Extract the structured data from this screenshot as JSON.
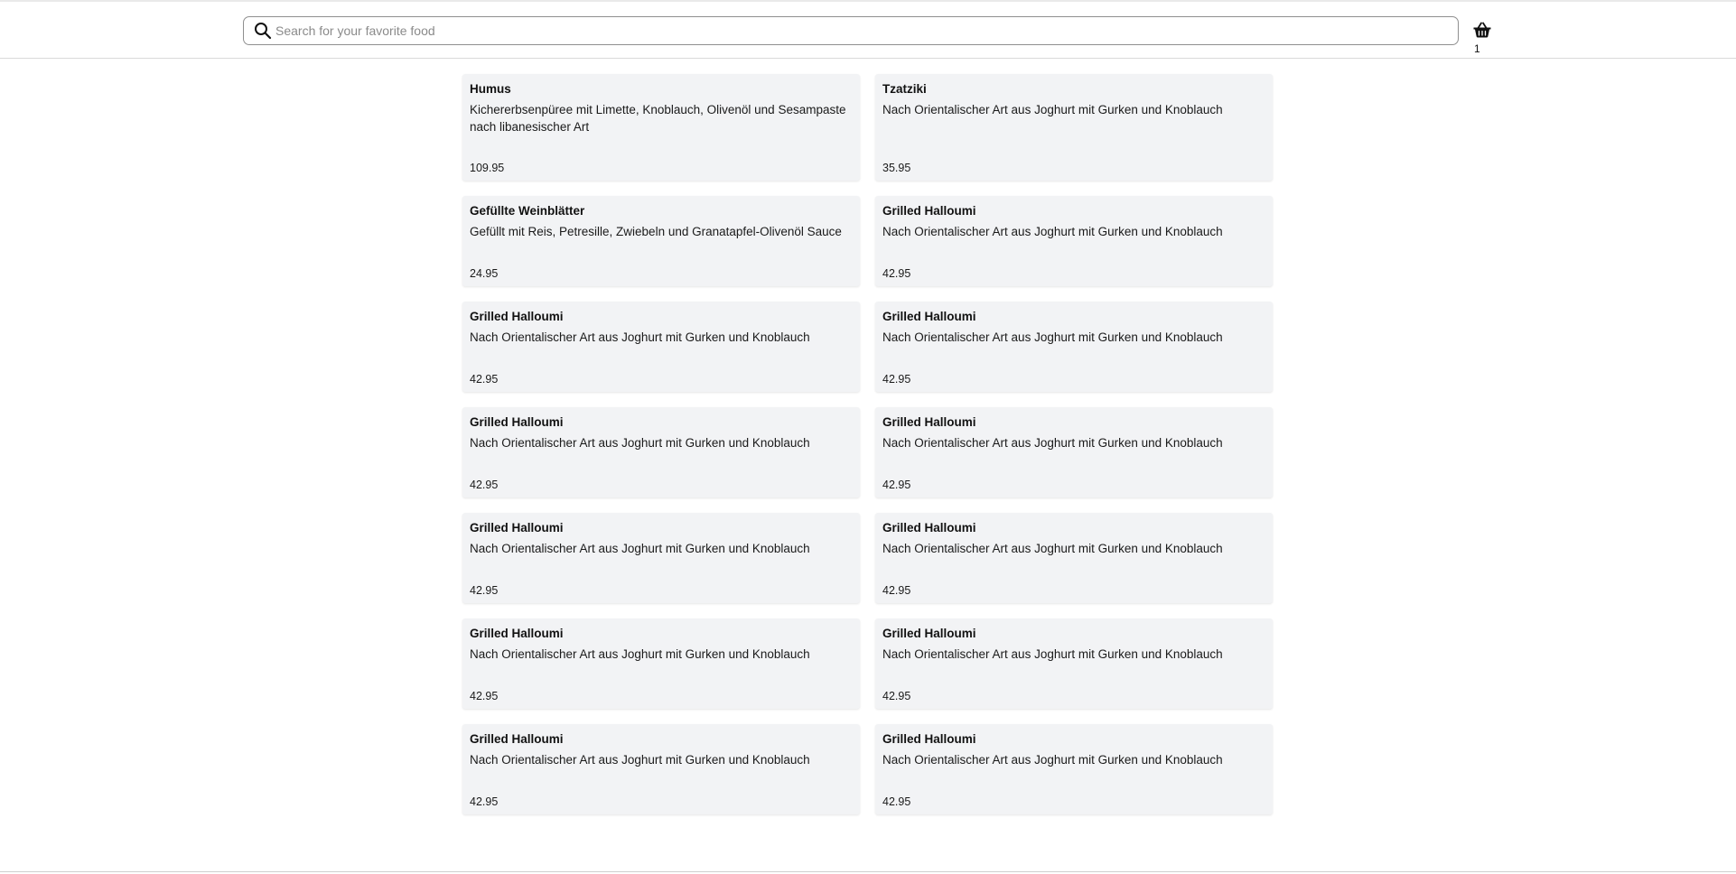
{
  "search": {
    "placeholder": "Search for your favorite food",
    "value": ""
  },
  "cart": {
    "icon": "shopping-basket-icon",
    "count": "1"
  },
  "menu": {
    "items": [
      {
        "name": "Humus",
        "description": "Kichererbsenpüree mit Limette, Knoblauch, Olivenöl und Sesampaste nach libanesischer Art",
        "price": "109.95"
      },
      {
        "name": "Tzatziki",
        "description": "Nach Orientalischer Art aus Joghurt mit Gurken und Knoblauch",
        "price": "35.95"
      },
      {
        "name": "Gefüllte Weinblätter",
        "description": "Gefüllt mit Reis, Petresille, Zwiebeln und Granatapfel-Olivenöl Sauce",
        "price": "24.95"
      },
      {
        "name": "Grilled Halloumi",
        "description": "Nach Orientalischer Art aus Joghurt mit Gurken und Knoblauch",
        "price": "42.95"
      },
      {
        "name": "Grilled Halloumi",
        "description": "Nach Orientalischer Art aus Joghurt mit Gurken und Knoblauch",
        "price": "42.95"
      },
      {
        "name": "Grilled Halloumi",
        "description": "Nach Orientalischer Art aus Joghurt mit Gurken und Knoblauch",
        "price": "42.95"
      },
      {
        "name": "Grilled Halloumi",
        "description": "Nach Orientalischer Art aus Joghurt mit Gurken und Knoblauch",
        "price": "42.95"
      },
      {
        "name": "Grilled Halloumi",
        "description": "Nach Orientalischer Art aus Joghurt mit Gurken und Knoblauch",
        "price": "42.95"
      },
      {
        "name": "Grilled Halloumi",
        "description": "Nach Orientalischer Art aus Joghurt mit Gurken und Knoblauch",
        "price": "42.95"
      },
      {
        "name": "Grilled Halloumi",
        "description": "Nach Orientalischer Art aus Joghurt mit Gurken und Knoblauch",
        "price": "42.95"
      },
      {
        "name": "Grilled Halloumi",
        "description": "Nach Orientalischer Art aus Joghurt mit Gurken und Knoblauch",
        "price": "42.95"
      },
      {
        "name": "Grilled Halloumi",
        "description": "Nach Orientalischer Art aus Joghurt mit Gurken und Knoblauch",
        "price": "42.95"
      },
      {
        "name": "Grilled Halloumi",
        "description": "Nach Orientalischer Art aus Joghurt mit Gurken und Knoblauch",
        "price": "42.95"
      },
      {
        "name": "Grilled Halloumi",
        "description": "Nach Orientalischer Art aus Joghurt mit Gurken und Knoblauch",
        "price": "42.95"
      }
    ]
  }
}
